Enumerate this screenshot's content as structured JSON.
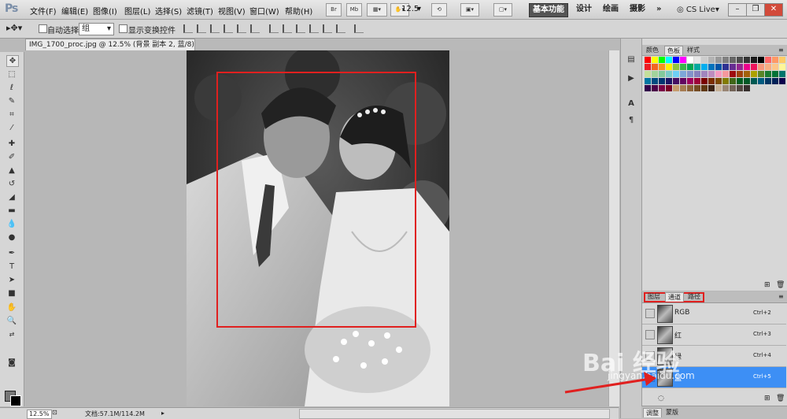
{
  "app": {
    "logo": "Ps"
  },
  "menu": [
    "文件(F)",
    "编辑(E)",
    "图像(I)",
    "图层(L)",
    "选择(S)",
    "滤镜(T)",
    "视图(V)",
    "窗口(W)",
    "帮助(H)"
  ],
  "menubar_buttons": [
    "Br",
    "Mb"
  ],
  "zoom_level": "12.5",
  "workspaces": [
    "基本功能",
    "设计",
    "绘画",
    "摄影",
    "»"
  ],
  "cs_live": "CS Live",
  "window_controls": [
    "–",
    "❐",
    "✕"
  ],
  "options": {
    "auto_select_label": "自动选择:",
    "group_value": "组",
    "show_transform_label": "显示变换控件"
  },
  "document": {
    "tab_title": "IMG_1700_proc.jpg @ 12.5% (背景 副本 2, 蓝/8) *",
    "close": "✕"
  },
  "status": {
    "zoom": "12.5%",
    "doc_info": "文档:57.1M/114.2M"
  },
  "swatches_panel": {
    "tabs": [
      "颜色",
      "色板",
      "样式"
    ],
    "active_tab": 1
  },
  "channels_panel": {
    "tabs": [
      "图层",
      "通道",
      "路径"
    ],
    "active_tab": 1,
    "rows": [
      {
        "name": "RGB",
        "shortcut": "Ctrl+2"
      },
      {
        "name": "红",
        "shortcut": "Ctrl+3"
      },
      {
        "name": "绿",
        "shortcut": "Ctrl+4"
      },
      {
        "name": "蓝",
        "shortcut": "Ctrl+5"
      }
    ],
    "selected_row": 3
  },
  "bottom_tabs": [
    "调整",
    "蒙版"
  ],
  "watermark": {
    "logo": "Bai 经验",
    "url": "jingyan.baidu.com"
  },
  "colors": {
    "highlight": "#e0201f",
    "selection_blue": "#3d8ff5"
  }
}
